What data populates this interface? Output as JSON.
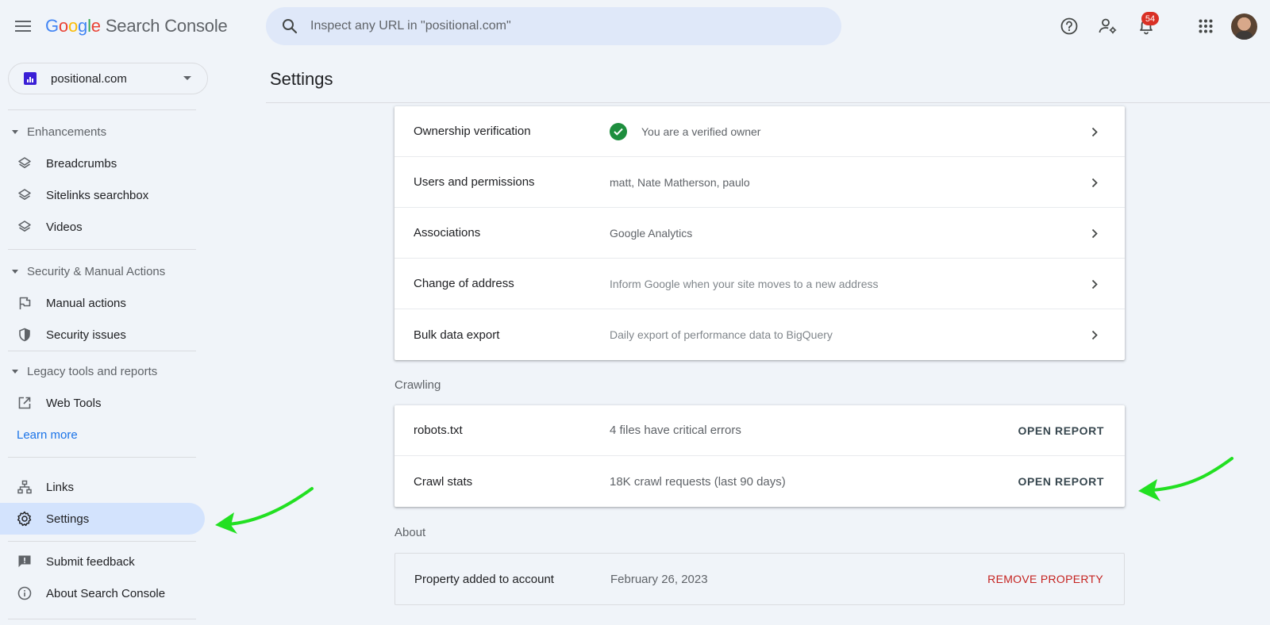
{
  "header": {
    "logo_google": [
      "G",
      "o",
      "o",
      "g",
      "l",
      "e"
    ],
    "product": "Search Console",
    "search_placeholder": "Inspect any URL in \"positional.com\"",
    "notification_count": "54",
    "icons": [
      "menu-icon",
      "search-icon",
      "help-icon",
      "manage-users-icon",
      "bell-icon",
      "apps-grid-icon",
      "avatar"
    ]
  },
  "property": {
    "name": "positional.com"
  },
  "sidebar": {
    "enhancements": {
      "title": "Enhancements",
      "items": [
        {
          "label": "Breadcrumbs",
          "icon": "layers-icon"
        },
        {
          "label": "Sitelinks searchbox",
          "icon": "layers-icon"
        },
        {
          "label": "Videos",
          "icon": "layers-icon"
        }
      ]
    },
    "security": {
      "title": "Security & Manual Actions",
      "items": [
        {
          "label": "Manual actions",
          "icon": "flag-icon"
        },
        {
          "label": "Security issues",
          "icon": "shield-icon"
        }
      ]
    },
    "legacy": {
      "title": "Legacy tools and reports",
      "items": [
        {
          "label": "Web Tools",
          "icon": "external-link-icon"
        }
      ],
      "learn_more": "Learn more"
    },
    "links": {
      "label": "Links",
      "icon": "sitemap-icon"
    },
    "settings": {
      "label": "Settings",
      "icon": "gear-icon",
      "active": true
    },
    "feedback": {
      "label": "Submit feedback",
      "icon": "feedback-icon"
    },
    "about": {
      "label": "About Search Console",
      "icon": "info-icon"
    }
  },
  "main": {
    "title": "Settings",
    "general": [
      {
        "label": "Ownership verification",
        "value": "You are a verified owner",
        "verified": true
      },
      {
        "label": "Users and permissions",
        "value": "matt, Nate Matherson, paulo"
      },
      {
        "label": "Associations",
        "value": "Google Analytics"
      },
      {
        "label": "Change of address",
        "value": "Inform Google when your site moves to a new address"
      },
      {
        "label": "Bulk data export",
        "value": "Daily export of performance data to BigQuery"
      }
    ],
    "crawling": {
      "title": "Crawling",
      "rows": [
        {
          "label": "robots.txt",
          "value": "4 files have critical errors",
          "action": "OPEN REPORT"
        },
        {
          "label": "Crawl stats",
          "value": "18K crawl requests (last 90 days)",
          "action": "OPEN REPORT"
        }
      ]
    },
    "about": {
      "title": "About",
      "rows": [
        {
          "label": "Property added to account",
          "value": "February 26, 2023",
          "action": "REMOVE PROPERTY"
        }
      ]
    }
  },
  "colors": {
    "background": "#f0f4f9",
    "accent": "#1a73e8",
    "active_nav": "#d3e3fd",
    "verified_green": "#1e8e3e",
    "danger_red": "#c5221f",
    "annotation_arrow": "#22e022"
  }
}
